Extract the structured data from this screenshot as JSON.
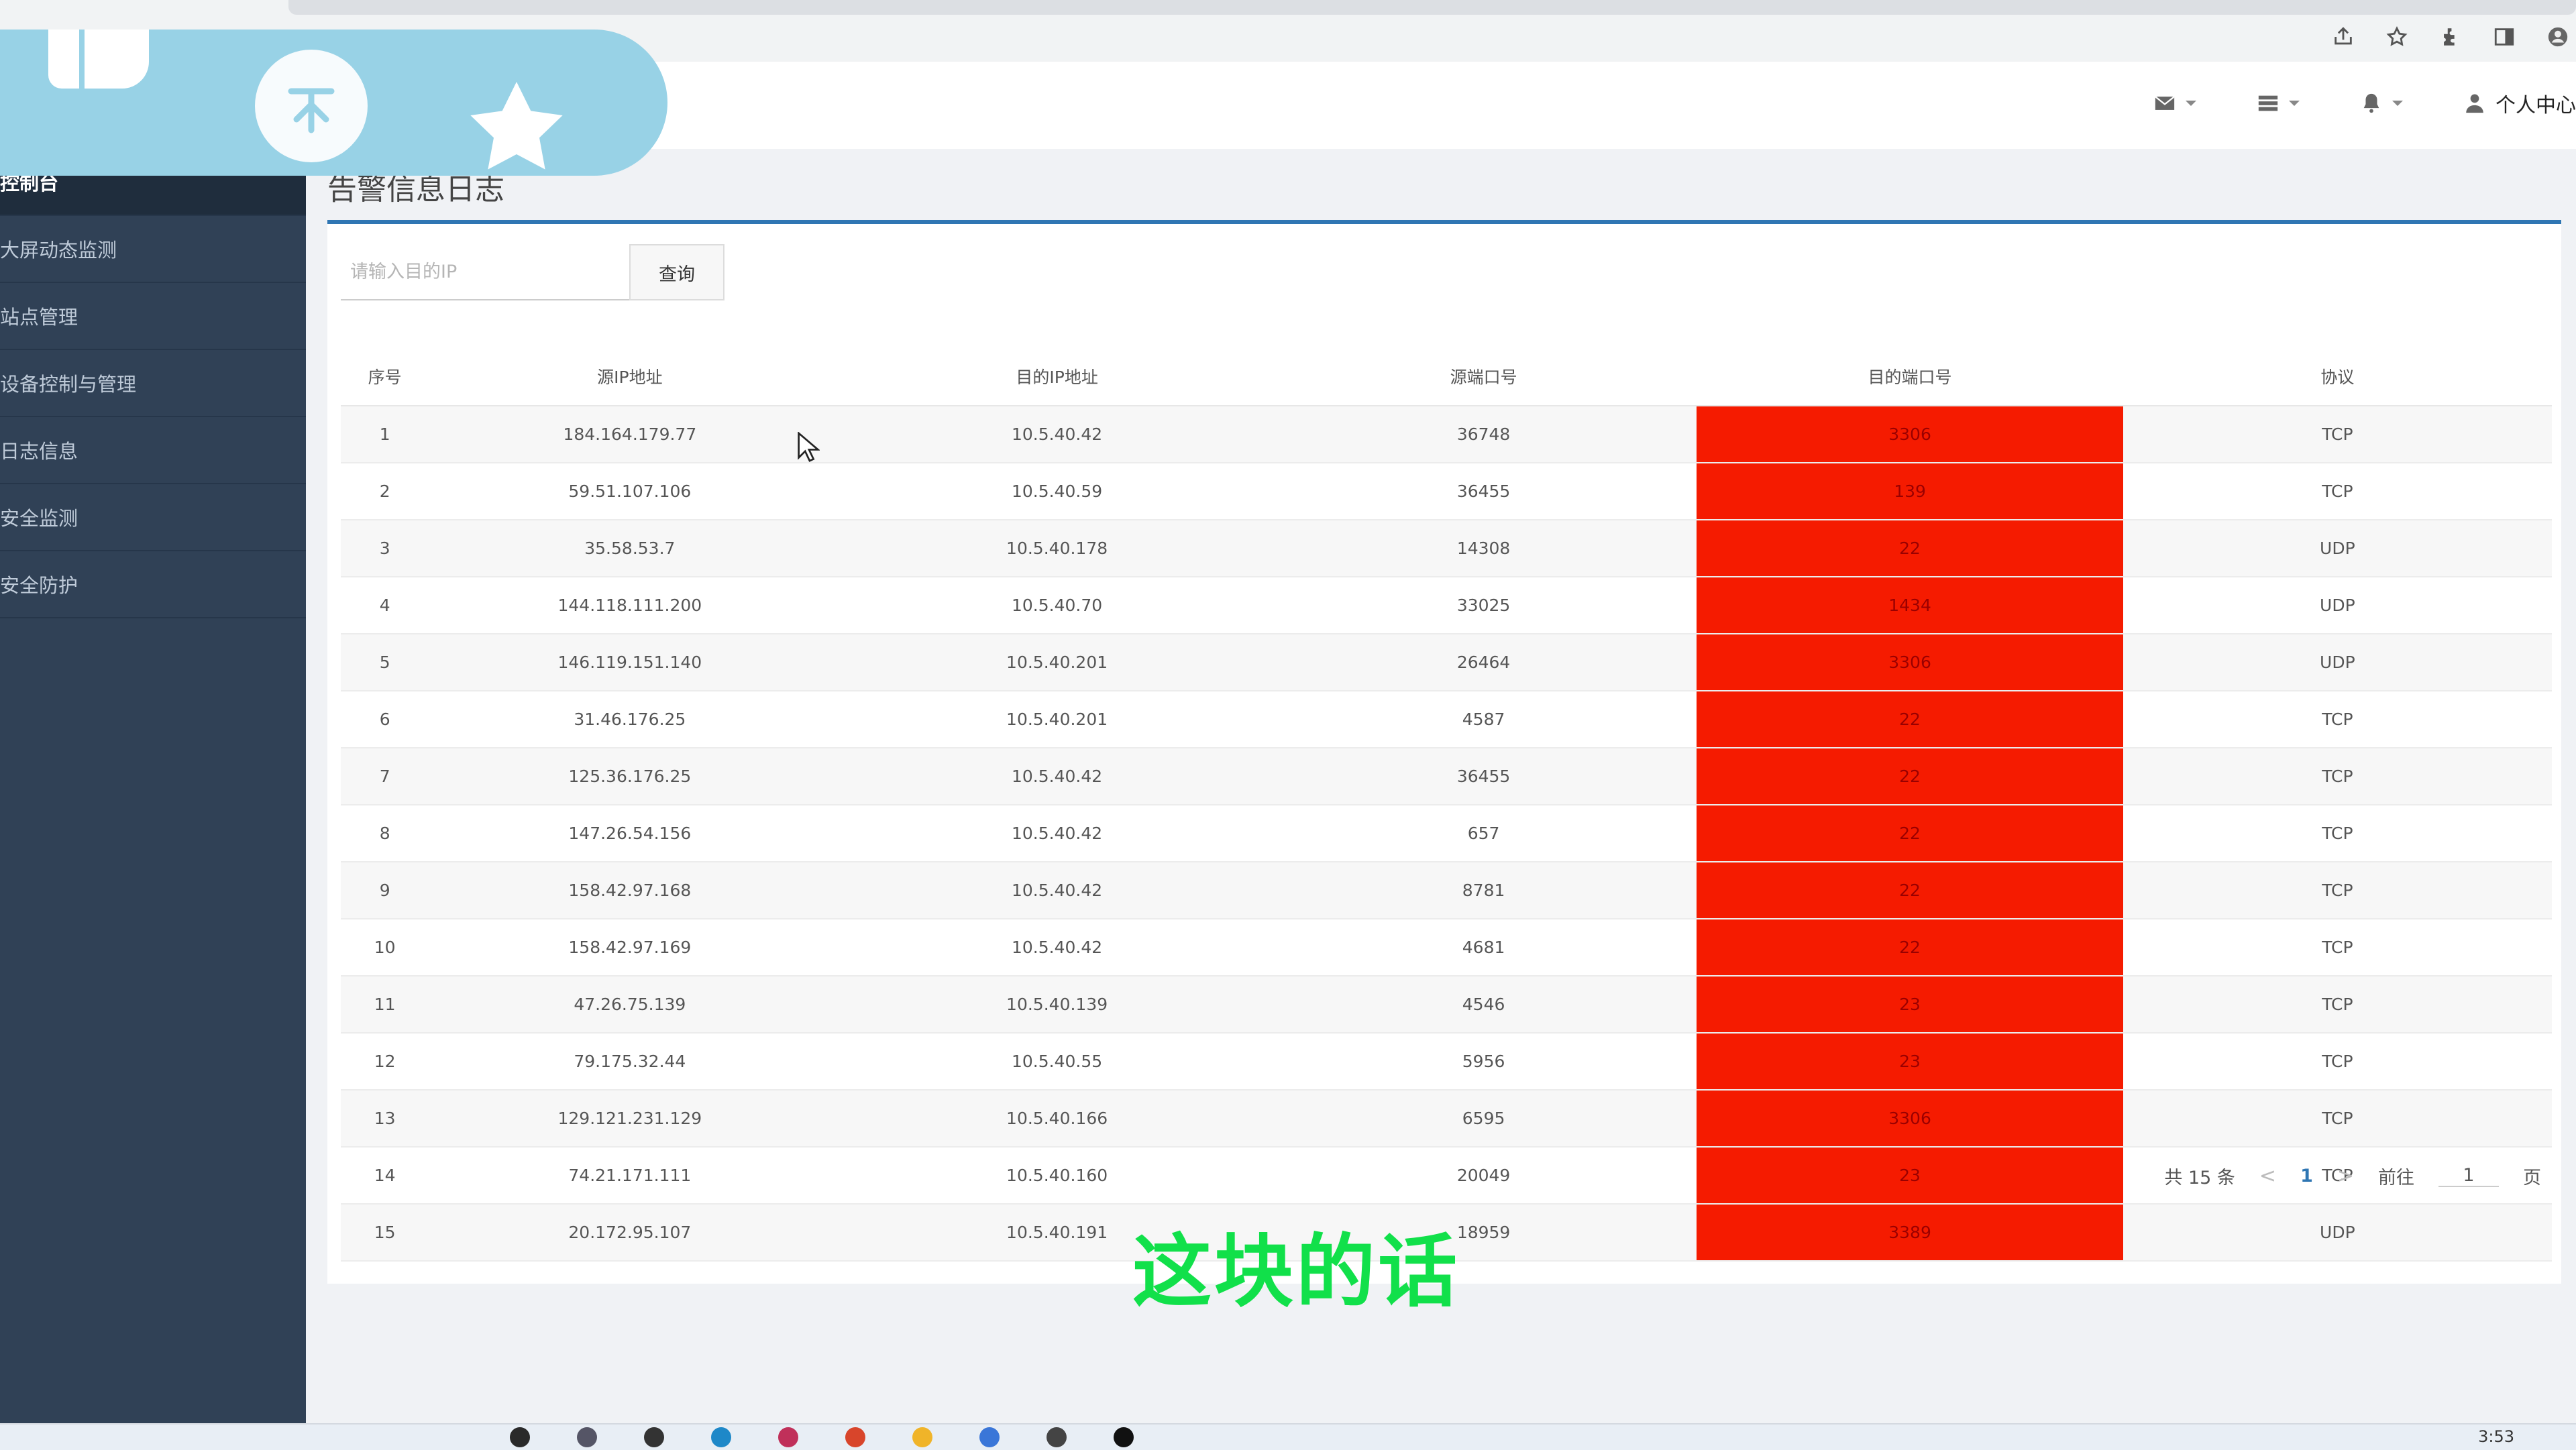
{
  "header": {
    "user_center_label": "个人中心"
  },
  "sidebar": {
    "items": [
      {
        "label": "控制台"
      },
      {
        "label": "大屏动态监测"
      },
      {
        "label": "站点管理"
      },
      {
        "label": "设备控制与管理"
      },
      {
        "label": "日志信息"
      },
      {
        "label": "安全监测"
      },
      {
        "label": "安全防护"
      }
    ]
  },
  "main": {
    "page_title": "告警信息日志",
    "search": {
      "placeholder": "请输入目的IP",
      "button_label": "查询"
    },
    "table": {
      "columns": [
        "序号",
        "源IP地址",
        "目的IP地址",
        "源端口号",
        "目的端口号",
        "协议"
      ],
      "rows": [
        [
          "1",
          "184.164.179.77",
          "10.5.40.42",
          "36748",
          "3306",
          "TCP"
        ],
        [
          "2",
          "59.51.107.106",
          "10.5.40.59",
          "36455",
          "139",
          "TCP"
        ],
        [
          "3",
          "35.58.53.7",
          "10.5.40.178",
          "14308",
          "22",
          "UDP"
        ],
        [
          "4",
          "144.118.111.200",
          "10.5.40.70",
          "33025",
          "1434",
          "UDP"
        ],
        [
          "5",
          "146.119.151.140",
          "10.5.40.201",
          "26464",
          "3306",
          "UDP"
        ],
        [
          "6",
          "31.46.176.25",
          "10.5.40.201",
          "4587",
          "22",
          "TCP"
        ],
        [
          "7",
          "125.36.176.25",
          "10.5.40.42",
          "36455",
          "22",
          "TCP"
        ],
        [
          "8",
          "147.26.54.156",
          "10.5.40.42",
          "657",
          "22",
          "TCP"
        ],
        [
          "9",
          "158.42.97.168",
          "10.5.40.42",
          "8781",
          "22",
          "TCP"
        ],
        [
          "10",
          "158.42.97.169",
          "10.5.40.42",
          "4681",
          "22",
          "TCP"
        ],
        [
          "11",
          "47.26.75.139",
          "10.5.40.139",
          "4546",
          "23",
          "TCP"
        ],
        [
          "12",
          "79.175.32.44",
          "10.5.40.55",
          "5956",
          "23",
          "TCP"
        ],
        [
          "13",
          "129.121.231.129",
          "10.5.40.166",
          "6595",
          "3306",
          "TCP"
        ],
        [
          "14",
          "74.21.171.111",
          "10.5.40.160",
          "20049",
          "23",
          "TCP"
        ],
        [
          "15",
          "20.172.95.107",
          "10.5.40.191",
          "18959",
          "3389",
          "UDP"
        ]
      ]
    },
    "pagination": {
      "total_label": "共 15 条",
      "prev": "<",
      "current_page": "1",
      "next": ">",
      "goto_prefix": "前往",
      "goto_value": "1",
      "goto_suffix": "页"
    }
  },
  "subtitle": "这块的话",
  "taskbar": {
    "clock": "3:53"
  },
  "colors": {
    "sidebar_bg": "#304156",
    "accent": "#2f76b3",
    "alert_cell": "#f51b00",
    "subtitle_green": "#11e04a",
    "overlay_blue": "#98d2e6"
  }
}
